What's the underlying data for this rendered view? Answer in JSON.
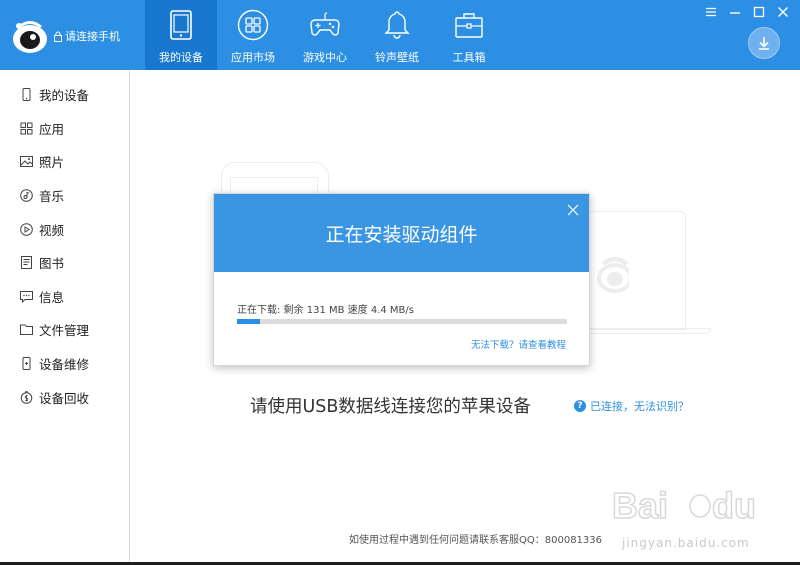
{
  "header": {
    "device_status": "请连接手机",
    "nav": [
      {
        "label": "我的设备",
        "icon": "tablet-icon",
        "active": true
      },
      {
        "label": "应用市场",
        "icon": "apps-grid-icon",
        "active": false
      },
      {
        "label": "游戏中心",
        "icon": "gamepad-icon",
        "active": false
      },
      {
        "label": "铃声壁纸",
        "icon": "bell-icon",
        "active": false
      },
      {
        "label": "工具箱",
        "icon": "toolbox-icon",
        "active": false
      }
    ],
    "colors": {
      "bar": "#2d8fe3",
      "active": "#1877cf"
    }
  },
  "sidebar": {
    "items": [
      {
        "label": "我的设备",
        "icon": "phone-icon"
      },
      {
        "label": "应用",
        "icon": "apps-icon"
      },
      {
        "label": "照片",
        "icon": "photo-icon"
      },
      {
        "label": "音乐",
        "icon": "music-icon"
      },
      {
        "label": "视频",
        "icon": "video-icon"
      },
      {
        "label": "图书",
        "icon": "book-icon"
      },
      {
        "label": "信息",
        "icon": "message-icon"
      },
      {
        "label": "文件管理",
        "icon": "folder-icon"
      },
      {
        "label": "设备维修",
        "icon": "repair-icon"
      },
      {
        "label": "设备回收",
        "icon": "recycle-icon"
      }
    ]
  },
  "main": {
    "message": "请使用USB数据线连接您的苹果设备",
    "help_link": "已连接，无法识别？",
    "footer": "如使用过程中遇到任何问题请联系客服QQ：800081336",
    "watermark_site": "jingyan.baidu.com"
  },
  "modal": {
    "title": "正在安装驱动组件",
    "status": "正在下载: 剩余 131 MB 速度 4.4 MB/s",
    "progress": 0.07,
    "tutorial_link": "无法下载？请查看教程"
  }
}
